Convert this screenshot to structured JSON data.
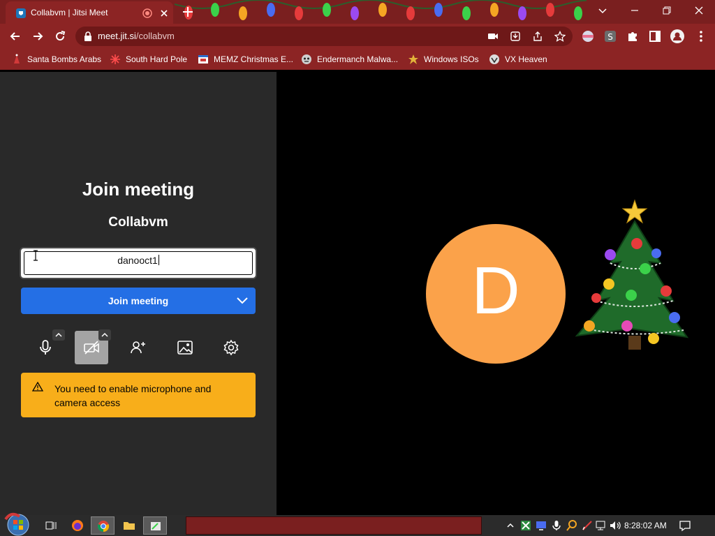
{
  "browser": {
    "tab": {
      "title": "Collabvm | Jitsi Meet"
    },
    "address": {
      "host": "meet.jit.si",
      "path": "/collabvm"
    },
    "bookmarks": [
      {
        "label": "Santa Bombs Arabs",
        "icon": "santa-icon"
      },
      {
        "label": "South Hard Pole",
        "icon": "snowflake-icon"
      },
      {
        "label": "MEMZ Christmas E...",
        "icon": "memz-icon"
      },
      {
        "label": "Endermanch Malwa...",
        "icon": "enderman-icon"
      },
      {
        "label": "Windows ISOs",
        "icon": "windows-isos-icon"
      },
      {
        "label": "VX Heaven",
        "icon": "vx-heaven-icon"
      }
    ]
  },
  "prejoin": {
    "title": "Join meeting",
    "room_name": "Collabvm",
    "name_value": "danooct1",
    "join_label": "Join meeting",
    "warning": "You need to enable microphone and camera access"
  },
  "participant": {
    "initial": "D",
    "avatar_color": "#fba24a"
  },
  "taskbar": {
    "clock": "8:28:02 AM"
  },
  "colors": {
    "join_button": "#246fe5",
    "warning_bg": "#f8ae1a",
    "browser_frame": "#8c2424"
  }
}
